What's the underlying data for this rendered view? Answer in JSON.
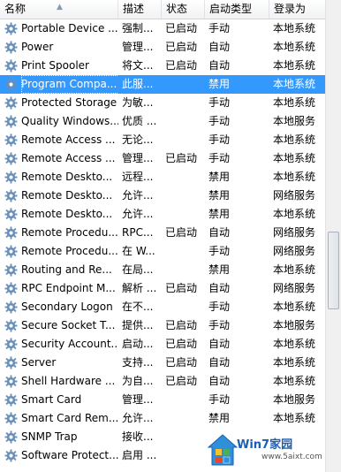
{
  "columns": [
    "名称",
    "描述",
    "状态",
    "启动类型",
    "登录为"
  ],
  "rows": [
    {
      "name": "Portable Device ...",
      "desc": "强制...",
      "status": "已启动",
      "startup": "手动",
      "logon": "本地系统"
    },
    {
      "name": "Power",
      "desc": "管理...",
      "status": "已启动",
      "startup": "自动",
      "logon": "本地系统"
    },
    {
      "name": "Print Spooler",
      "desc": "将文...",
      "status": "已启动",
      "startup": "自动",
      "logon": "本地系统"
    },
    {
      "name": "Program Compa...",
      "desc": "此服...",
      "status": "",
      "startup": "禁用",
      "logon": "本地系统",
      "selected": true
    },
    {
      "name": "Protected Storage",
      "desc": "为敏...",
      "status": "",
      "startup": "手动",
      "logon": "本地系统"
    },
    {
      "name": "Quality Windows...",
      "desc": "优质 ...",
      "status": "",
      "startup": "手动",
      "logon": "本地服务"
    },
    {
      "name": "Remote Access ...",
      "desc": "无论...",
      "status": "",
      "startup": "手动",
      "logon": "本地系统"
    },
    {
      "name": "Remote Access ...",
      "desc": "管理...",
      "status": "已启动",
      "startup": "手动",
      "logon": "本地系统"
    },
    {
      "name": "Remote Deskto...",
      "desc": "远程...",
      "status": "",
      "startup": "禁用",
      "logon": "本地系统"
    },
    {
      "name": "Remote Deskto...",
      "desc": "允许...",
      "status": "",
      "startup": "禁用",
      "logon": "网络服务"
    },
    {
      "name": "Remote Deskto...",
      "desc": "允许...",
      "status": "",
      "startup": "禁用",
      "logon": "本地系统"
    },
    {
      "name": "Remote Procedu...",
      "desc": "RPC...",
      "status": "已启动",
      "startup": "自动",
      "logon": "网络服务"
    },
    {
      "name": "Remote Procedu...",
      "desc": "在 W...",
      "status": "",
      "startup": "手动",
      "logon": "网络服务"
    },
    {
      "name": "Routing and Re...",
      "desc": "在局...",
      "status": "",
      "startup": "禁用",
      "logon": "本地系统"
    },
    {
      "name": "RPC Endpoint M...",
      "desc": "解析 ...",
      "status": "已启动",
      "startup": "自动",
      "logon": "网络服务"
    },
    {
      "name": "Secondary Logon",
      "desc": "在不...",
      "status": "",
      "startup": "手动",
      "logon": "本地系统"
    },
    {
      "name": "Secure Socket T...",
      "desc": "提供...",
      "status": "已启动",
      "startup": "手动",
      "logon": "本地服务"
    },
    {
      "name": "Security Account...",
      "desc": "启动...",
      "status": "已启动",
      "startup": "自动",
      "logon": "本地系统"
    },
    {
      "name": "Server",
      "desc": "支持...",
      "status": "已启动",
      "startup": "自动",
      "logon": "本地系统"
    },
    {
      "name": "Shell Hardware ...",
      "desc": "为自...",
      "status": "已启动",
      "startup": "自动",
      "logon": "本地系统"
    },
    {
      "name": "Smart Card",
      "desc": "管理...",
      "status": "",
      "startup": "手动",
      "logon": "本地服务"
    },
    {
      "name": "Smart Card Rem...",
      "desc": "允许...",
      "status": "",
      "startup": "禁用",
      "logon": "本地系统"
    },
    {
      "name": "SNMP Trap",
      "desc": "接收...",
      "status": "",
      "startup": "",
      "logon": ""
    },
    {
      "name": "Software Protect...",
      "desc": "启用 ...",
      "status": "",
      "startup": "",
      "logon": ""
    }
  ],
  "watermark": {
    "text": "Win7家园",
    "url": "www.5aixt.com"
  },
  "colors": {
    "selection": "#3399ff",
    "gear": "#6a8fb7"
  }
}
